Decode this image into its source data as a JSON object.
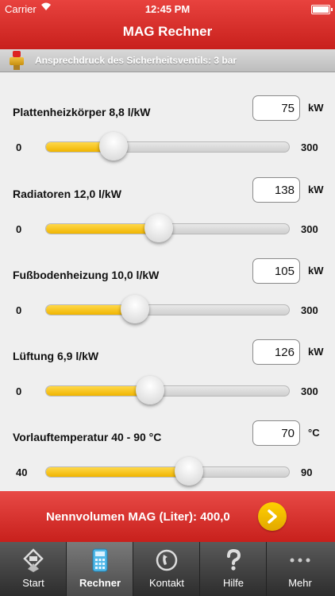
{
  "status": {
    "carrier": "Carrier",
    "time": "12:45 PM"
  },
  "header": {
    "title": "MAG Rechner"
  },
  "info": {
    "text": "Ansprechdruck des Sicherheitsventils: 3 bar"
  },
  "rows": [
    {
      "label": "Plattenheizkörper 8,8 l/kW",
      "value": "75",
      "unit": "kW",
      "min": "0",
      "max": "300",
      "fraction": 0.25
    },
    {
      "label": "Radiatoren 12,0 l/kW",
      "value": "138",
      "unit": "kW",
      "min": "0",
      "max": "300",
      "fraction": 0.46
    },
    {
      "label": "Fußbodenheizung 10,0 l/kW",
      "value": "105",
      "unit": "kW",
      "min": "0",
      "max": "300",
      "fraction": 0.35
    },
    {
      "label": "Lüftung 6,9 l/kW",
      "value": "126",
      "unit": "kW",
      "min": "0",
      "max": "300",
      "fraction": 0.42
    },
    {
      "label": "Vorlauftemperatur 40 - 90 °C",
      "value": "70",
      "unit": "°C",
      "min": "40",
      "max": "90",
      "fraction": 0.6
    }
  ],
  "result": {
    "text": "Nennvolumen MAG (Liter): 400,0"
  },
  "tabs": [
    {
      "label": "Start",
      "icon": "start-logo-icon"
    },
    {
      "label": "Rechner",
      "icon": "calculator-icon",
      "active": true
    },
    {
      "label": "Kontakt",
      "icon": "phone-icon"
    },
    {
      "label": "Hilfe",
      "icon": "question-icon"
    },
    {
      "label": "Mehr",
      "icon": "more-dots-icon"
    }
  ],
  "colors": {
    "accent": "#d8302c",
    "slider_fill": "#f5c518",
    "tabbar": "#3a3a3a"
  }
}
